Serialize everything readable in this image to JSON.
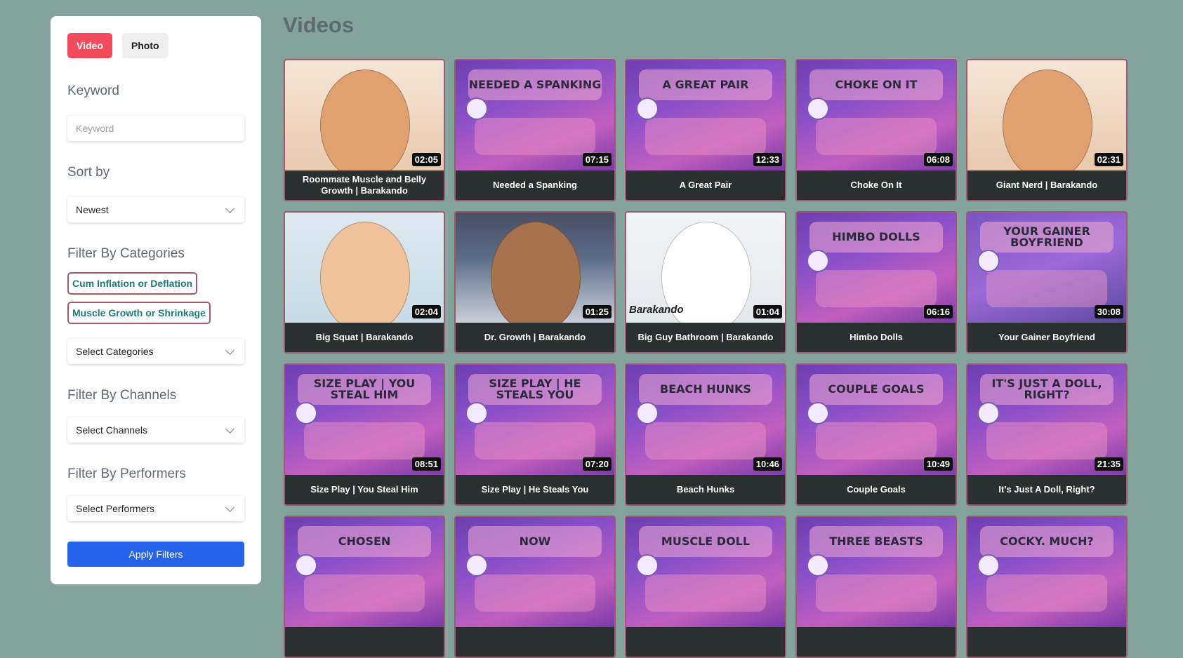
{
  "sidebar": {
    "type_toggle": {
      "video_label": "Video",
      "photo_label": "Photo"
    },
    "keyword": {
      "label": "Keyword",
      "placeholder": "Keyword"
    },
    "sort": {
      "label": "Sort by",
      "value": "Newest"
    },
    "categories": {
      "label": "Filter By Categories",
      "selected": [
        "Cum Inflation or Deflation",
        "Muscle Growth or Shrinkage"
      ],
      "select_placeholder": "Select Categories"
    },
    "channels": {
      "label": "Filter By Channels",
      "select_placeholder": "Select Channels"
    },
    "performers": {
      "label": "Filter By Performers",
      "select_placeholder": "Select Performers"
    },
    "apply_label": "Apply Filters"
  },
  "main": {
    "title": "Videos",
    "videos": [
      {
        "title": "Roommate Muscle and Belly Growth | Barakando",
        "duration": "02:05",
        "thumb_text": "",
        "style": "beige"
      },
      {
        "title": "Needed a Spanking",
        "duration": "07:15",
        "thumb_text": "NEEDED A SPANKING",
        "style": "purple"
      },
      {
        "title": "A Great Pair",
        "duration": "12:33",
        "thumb_text": "A GREAT PAIR",
        "style": "purple"
      },
      {
        "title": "Choke On It",
        "duration": "06:08",
        "thumb_text": "CHOKE ON IT",
        "style": "purple"
      },
      {
        "title": "Giant Nerd | Barakando",
        "duration": "02:31",
        "thumb_text": "",
        "style": "beige"
      },
      {
        "title": "Big Squat | Barakando",
        "duration": "02:04",
        "thumb_text": "",
        "style": "lightblue"
      },
      {
        "title": "Dr. Growth | Barakando",
        "duration": "01:25",
        "thumb_text": "",
        "style": "brown"
      },
      {
        "title": "Big Guy Bathroom | Barakando",
        "duration": "01:04",
        "thumb_text": "Barakando",
        "style": "white"
      },
      {
        "title": "Himbo Dolls",
        "duration": "06:16",
        "thumb_text": "HIMBO DOLLS",
        "style": "purple"
      },
      {
        "title": "Your Gainer Boyfriend",
        "duration": "30:08",
        "thumb_text": "YOUR GAINER BOYFRIEND",
        "style": "violet"
      },
      {
        "title": "Size Play | You Steal Him",
        "duration": "08:51",
        "thumb_text": "SIZE PLAY | YOU STEAL HIM",
        "style": "purple"
      },
      {
        "title": "Size Play | He Steals You",
        "duration": "07:20",
        "thumb_text": "SIZE PLAY | HE STEALS YOU",
        "style": "purple"
      },
      {
        "title": "Beach Hunks",
        "duration": "10:46",
        "thumb_text": "BEACH HUNKS",
        "style": "purple"
      },
      {
        "title": "Couple Goals",
        "duration": "10:49",
        "thumb_text": "COUPLE GOALS",
        "style": "purple"
      },
      {
        "title": "It's Just A Doll, Right?",
        "duration": "21:35",
        "thumb_text": "IT'S JUST A DOLL, RIGHT?",
        "style": "purple"
      },
      {
        "title": "",
        "duration": "",
        "thumb_text": "CHOSEN",
        "style": "purple"
      },
      {
        "title": "",
        "duration": "",
        "thumb_text": "NOW",
        "style": "purple"
      },
      {
        "title": "",
        "duration": "",
        "thumb_text": "MUSCLE DOLL",
        "style": "purple"
      },
      {
        "title": "",
        "duration": "",
        "thumb_text": "THREE BEASTS",
        "style": "purple"
      },
      {
        "title": "",
        "duration": "",
        "thumb_text": "COCKY. MUCH?",
        "style": "purple"
      }
    ]
  }
}
